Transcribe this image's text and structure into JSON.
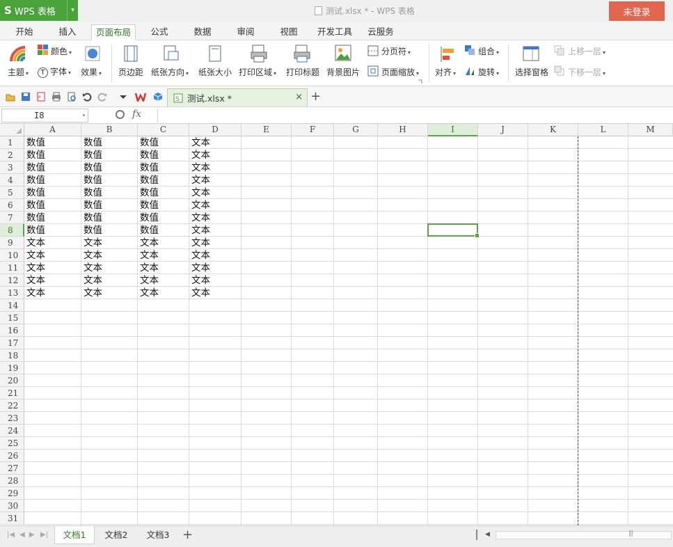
{
  "app": {
    "name": "WPS 表格",
    "logo_glyph": "S",
    "menu_caret": "▾"
  },
  "window": {
    "title": "测试.xlsx * - WPS 表格",
    "login_label": "未登录",
    "login_color": "#e2664e",
    "brand_color": "#4aa23a"
  },
  "menu_tabs": [
    {
      "label": "开始",
      "active": false
    },
    {
      "label": "插入",
      "active": false
    },
    {
      "label": "页面布局",
      "active": true
    },
    {
      "label": "公式",
      "active": false
    },
    {
      "label": "数据",
      "active": false
    },
    {
      "label": "审阅",
      "active": false
    },
    {
      "label": "视图",
      "active": false
    },
    {
      "label": "开发工具",
      "active": false
    },
    {
      "label": "云服务",
      "active": false
    }
  ],
  "ribbon": {
    "theme": "主题",
    "colors": "颜色",
    "fonts": "字体",
    "effects": "效果",
    "margins": "页边距",
    "orientation": "纸张方向",
    "paper_size": "纸张大小",
    "print_area": "打印区域",
    "print_titles": "打印标题",
    "background": "背景图片",
    "page_break": "分页符",
    "page_zoom": "页面缩放",
    "align": "对齐",
    "group": "组合",
    "rotate": "旋转",
    "selection_pane": "选择窗格",
    "bring_forward": "上移一层",
    "send_backward": "下移一层"
  },
  "file_tab": {
    "name": "测试.xlsx *",
    "close": "×",
    "add": "+"
  },
  "formula_bar": {
    "cell_ref": "I8",
    "fx": "fx",
    "value": ""
  },
  "columns": [
    "A",
    "B",
    "C",
    "D",
    "E",
    "F",
    "G",
    "H",
    "I",
    "J",
    "K",
    "L",
    "M"
  ],
  "selected_column": "I",
  "selected_row": 8,
  "row_numbers": [
    "1",
    "2",
    "3",
    "4",
    "5",
    "6",
    "7",
    "8",
    "9",
    "10",
    "11",
    "12",
    "13",
    "14",
    "15",
    "16",
    "17",
    "18",
    "19",
    "20",
    "21",
    "22",
    "23",
    "24",
    "25",
    "26",
    "27",
    "28",
    "29",
    "30",
    "31"
  ],
  "cells": [
    [
      "数值",
      "数值",
      "数值",
      "文本"
    ],
    [
      "数值",
      "数值",
      "数值",
      "文本"
    ],
    [
      "数值",
      "数值",
      "数值",
      "文本"
    ],
    [
      "数值",
      "数值",
      "数值",
      "文本"
    ],
    [
      "数值",
      "数值",
      "数值",
      "文本"
    ],
    [
      "数值",
      "数值",
      "数值",
      "文本"
    ],
    [
      "数值",
      "数值",
      "数值",
      "文本"
    ],
    [
      "数值",
      "数值",
      "数值",
      "文本"
    ],
    [
      "文本",
      "文本",
      "文本",
      "文本"
    ],
    [
      "文本",
      "文本",
      "文本",
      "文本"
    ],
    [
      "文本",
      "文本",
      "文本",
      "文本"
    ],
    [
      "文本",
      "文本",
      "文本",
      "文本"
    ],
    [
      "文本",
      "文本",
      "文本",
      "文本"
    ]
  ],
  "sheets": [
    {
      "label": "文档1",
      "active": true
    },
    {
      "label": "文档2",
      "active": false
    },
    {
      "label": "文档3",
      "active": false
    }
  ],
  "sheet_add": "+",
  "scroll_grip": "|||"
}
